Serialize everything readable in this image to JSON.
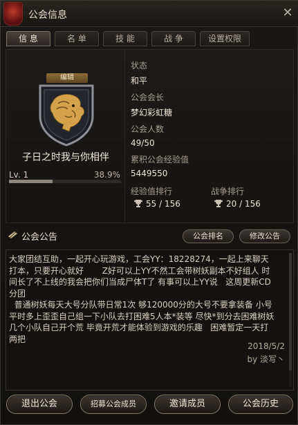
{
  "window": {
    "title": "公会信息",
    "emblem_icon": "guild-red-emblem-icon",
    "close_icon": "close-icon"
  },
  "tabs": [
    {
      "label": "信 息",
      "active": true
    },
    {
      "label": "名 单",
      "active": false
    },
    {
      "label": "技 能",
      "active": false
    },
    {
      "label": "战 争",
      "active": false
    },
    {
      "label": "设置权限",
      "active": false
    }
  ],
  "guild": {
    "edit_label": "编辑",
    "emblem_icon": "lion-shield-icon",
    "name": "子日之时我与你相伴",
    "level_label": "Lv. 1",
    "exp_percent_label": "38.9%",
    "exp_fraction": 0.389
  },
  "info": {
    "status_label": "状态",
    "status_value": "和平",
    "leader_label": "公会会长",
    "leader_value": "梦幻彩虹糖",
    "members_label": "公会人数",
    "members_value": "49/50",
    "exp_label": "累积公会经验值",
    "exp_value": "5449550",
    "exp_rank_label": "经验值排行",
    "exp_rank_value": "55 / 156",
    "war_rank_label": "战争排行",
    "war_rank_value": "20 / 156",
    "trophy_icon": "trophy-icon"
  },
  "notice": {
    "title": "公会公告",
    "scroll_icon": "scroll-quill-icon",
    "ranking_button": "公会排名",
    "edit_button": "修改公告",
    "text": "大家团结互助，一起开心玩游戏，工会YY：18228274，一起上来聊天\n打本，只要开心就好       Z好可以上YY不然工会带树妖副本不好组人 时\n间长了不上线的我会把你们当成尸体T了 有事可以上YY说   这周更新CD\n分团\n  普通树妖每天大号分队带日常1次 够120000分的大号不要拿装备 小号\n平时多上歪歪自己组一下小队去打困难5人本*装等 尽快*到分去困难树妖\n几个小队自己开个荒 毕竟开荒才能体验到游戏的乐趣   困难暂定一天打\n两把",
    "date": "2018/5/2",
    "author": "by 淡写丶"
  },
  "bottom_buttons": {
    "leave": "退出公会",
    "recruit": "招募公会成员",
    "invite": "邀请成员",
    "history": "公会历史"
  },
  "colors": {
    "accent_gold": "#c9a24e",
    "background": "#121110"
  }
}
